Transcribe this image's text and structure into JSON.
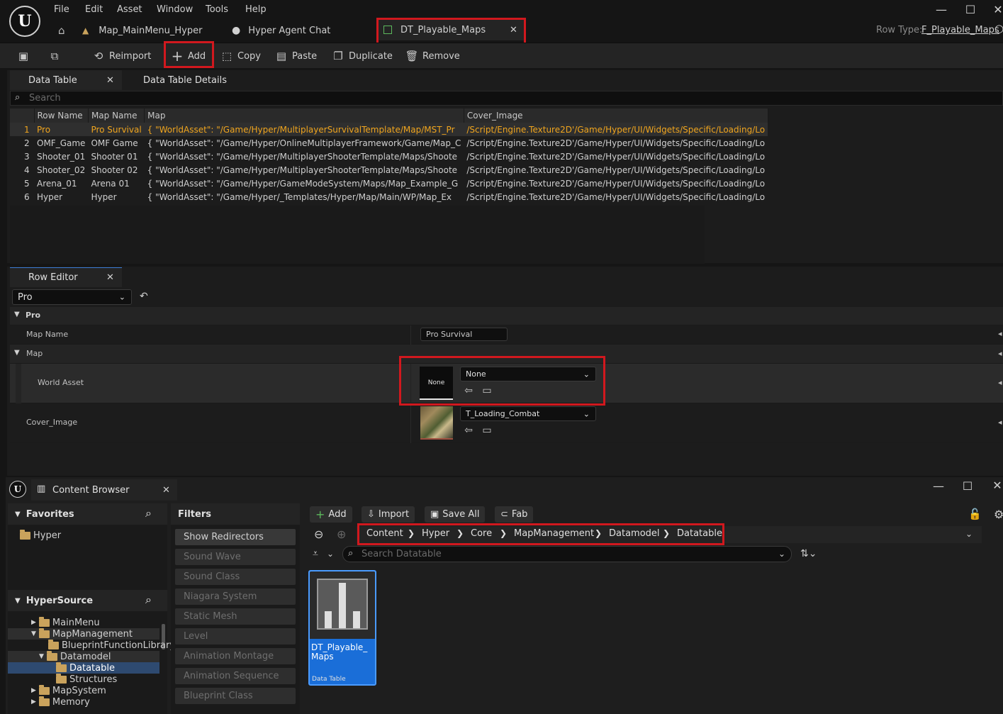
{
  "menu": [
    "File",
    "Edit",
    "Asset",
    "Window",
    "Tools",
    "Help"
  ],
  "tabs": [
    {
      "label": "Map_MainMenu_Hyper"
    },
    {
      "label": "Hyper Agent Chat"
    },
    {
      "label": "DT_Playable_Maps"
    }
  ],
  "row_type": {
    "label": "Row Type:",
    "value": "F_Playable_Maps"
  },
  "toolbar": {
    "reimport": "Reimport",
    "add": "Add",
    "copy": "Copy",
    "paste": "Paste",
    "duplicate": "Duplicate",
    "remove": "Remove"
  },
  "panels": {
    "data_table_tab": "Data Table",
    "details_tab": "Data Table Details",
    "search_placeholder": "Search",
    "row_editor_tab": "Row Editor"
  },
  "table": {
    "headers": [
      "Row Name",
      "Map Name",
      "Map",
      "Cover_Image"
    ],
    "rows": [
      {
        "index": "1",
        "row_name": "Pro",
        "map_name": "Pro Survival",
        "map": "{ \"WorldAsset\": \"/Game/Hyper/MultiplayerSurvivalTemplate/Map/MST_Pr",
        "cover": "/Script/Engine.Texture2D'/Game/Hyper/UI/Widgets/Specific/Loading/Lo"
      },
      {
        "index": "2",
        "row_name": "OMF_Game",
        "map_name": "OMF Game",
        "map": "{ \"WorldAsset\": \"/Game/Hyper/OnlineMultiplayerFramework/Game/Map_C",
        "cover": "/Script/Engine.Texture2D'/Game/Hyper/UI/Widgets/Specific/Loading/Lo"
      },
      {
        "index": "3",
        "row_name": "Shooter_01",
        "map_name": "Shooter 01",
        "map": "{ \"WorldAsset\": \"/Game/Hyper/MultiplayerShooterTemplate/Maps/Shoote",
        "cover": "/Script/Engine.Texture2D'/Game/Hyper/UI/Widgets/Specific/Loading/Lo"
      },
      {
        "index": "4",
        "row_name": "Shooter_02",
        "map_name": "Shooter 02",
        "map": "{ \"WorldAsset\": \"/Game/Hyper/MultiplayerShooterTemplate/Maps/Shoote",
        "cover": "/Script/Engine.Texture2D'/Game/Hyper/UI/Widgets/Specific/Loading/Lo"
      },
      {
        "index": "5",
        "row_name": "Arena_01",
        "map_name": "Arena 01",
        "map": "{ \"WorldAsset\": \"/Game/Hyper/GameModeSystem/Maps/Map_Example_G",
        "cover": "/Script/Engine.Texture2D'/Game/Hyper/UI/Widgets/Specific/Loading/Lo"
      },
      {
        "index": "6",
        "row_name": "Hyper",
        "map_name": "Hyper",
        "map": "{ \"WorldAsset\": \"/Game/Hyper/_Templates/Hyper/Map/Main/WP/Map_Ex",
        "cover": "/Script/Engine.Texture2D'/Game/Hyper/UI/Widgets/Specific/Loading/Lo"
      }
    ]
  },
  "row_editor": {
    "selected_row": "Pro",
    "section_pro": "Pro",
    "map_name_label": "Map Name",
    "map_name_value": "Pro Survival",
    "section_map": "Map",
    "world_asset_label": "World Asset",
    "world_asset_thumb": "None",
    "world_asset_value": "None",
    "cover_label": "Cover_Image",
    "cover_value": "T_Loading_Combat"
  },
  "content_browser": {
    "title": "Content Browser",
    "favorites": "Favorites",
    "favorites_items": [
      "Hyper"
    ],
    "source": "HyperSource",
    "tree": [
      {
        "label": "MainMenu"
      },
      {
        "label": "MapManagement"
      },
      {
        "label": "BlueprintFunctionLibrary"
      },
      {
        "label": "Datamodel"
      },
      {
        "label": "Datatable"
      },
      {
        "label": "Structures"
      },
      {
        "label": "MapSystem"
      },
      {
        "label": "Memory"
      }
    ],
    "filters_title": "Filters",
    "filters": [
      "Show Redirectors",
      "Sound Wave",
      "Sound Class",
      "Niagara System",
      "Static Mesh",
      "Level",
      "Animation Montage",
      "Animation Sequence",
      "Blueprint Class"
    ],
    "buttons": {
      "add": "Add",
      "import": "Import",
      "save_all": "Save All",
      "fab": "Fab"
    },
    "breadcrumbs": [
      "Content",
      "Hyper",
      "Core",
      "MapManagement",
      "Datamodel",
      "Datatable"
    ],
    "search_placeholder": "Search Datatable",
    "asset": {
      "name": "DT_Playable_Maps",
      "type": "Data Table"
    }
  },
  "colors": {
    "highlight": "#d1181e",
    "selected_row_text": "#f0a51e",
    "asset_tile": "#1a6ed8"
  }
}
